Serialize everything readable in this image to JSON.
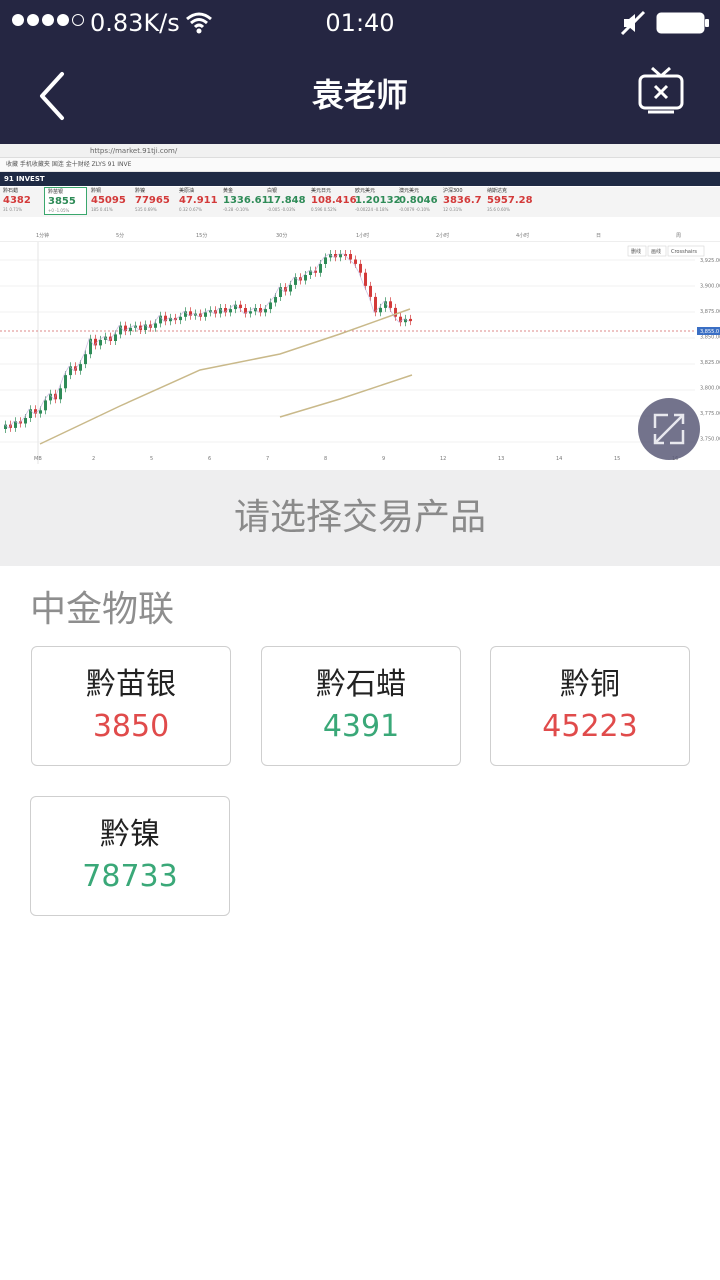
{
  "status_bar": {
    "net_speed": "0.83K/s",
    "time": "01:40"
  },
  "nav": {
    "title": "袁老师"
  },
  "video": {
    "browser_url": "https://market.91tji.com/",
    "bookmarks": "收藏  手机收藏夹  国连  金十财经  ZLYS  91 INVE",
    "site_name": "91 INVEST",
    "tickers": [
      {
        "name": "黔石蜡",
        "value": "4382",
        "change": "31  0.71%",
        "dir": "up"
      },
      {
        "name": "黔苗银",
        "value": "3855",
        "change": "+0  -1.05%",
        "dir": "down",
        "selected": true
      },
      {
        "name": "黔铜",
        "value": "45095",
        "change": "185  0.41%",
        "dir": "up"
      },
      {
        "name": "黔镍",
        "value": "77965",
        "change": "535  0.69%",
        "dir": "up"
      },
      {
        "name": "美原油",
        "value": "47.911",
        "change": "0.32  0.67%",
        "dir": "up"
      },
      {
        "name": "黄金",
        "value": "1336.61",
        "change": "-0.28  -0.10%",
        "dir": "down"
      },
      {
        "name": "白银",
        "value": "17.848",
        "change": "-0.005  -0.03%",
        "dir": "down"
      },
      {
        "name": "美元日元",
        "value": "108.416",
        "change": "0.596  0.52%",
        "dir": "up"
      },
      {
        "name": "欧元美元",
        "value": "1.20132",
        "change": "-0.00224  -0.18%",
        "dir": "down"
      },
      {
        "name": "澳元美元",
        "value": "0.8046",
        "change": "-0.0079  -0.10%",
        "dir": "down"
      },
      {
        "name": "沪深300",
        "value": "3836.7",
        "change": "12  0.31%",
        "dir": "up"
      },
      {
        "name": "纳斯达克",
        "value": "5957.28",
        "change": "35.6  0.60%",
        "dir": "up"
      }
    ],
    "timeframes": [
      "1分钟",
      "5分",
      "15分",
      "30分",
      "1小时",
      "2小时",
      "4小时",
      "日",
      "周"
    ],
    "chart_tools": [
      "删线",
      "画线",
      "Crosshairs"
    ],
    "price_ticks": [
      "3,925.00",
      "3,900.00",
      "3,875.00",
      "3,850.00",
      "3,825.00",
      "3,800.00",
      "3,775.00",
      "3,750.00"
    ],
    "date_ticks": [
      "MB",
      "2",
      "5",
      "6",
      "7",
      "8",
      "9",
      "12",
      "13",
      "14",
      "15",
      "16"
    ],
    "current_price_tag": "3,855.0"
  },
  "prompt": {
    "text": "请选择交易产品"
  },
  "products": {
    "section_title": "中金物联",
    "items": [
      {
        "name": "黔苗银",
        "price": "3850",
        "trend": "up"
      },
      {
        "name": "黔石蜡",
        "price": "4391",
        "trend": "down"
      },
      {
        "name": "黔铜",
        "price": "45223",
        "trend": "up"
      },
      {
        "name": "黔镍",
        "price": "78733",
        "trend": "down"
      }
    ]
  },
  "colors": {
    "header_bg": "#252642",
    "price_up": "#e04b4b",
    "price_down": "#3aa878",
    "prompt_bg": "#eeeeef"
  }
}
